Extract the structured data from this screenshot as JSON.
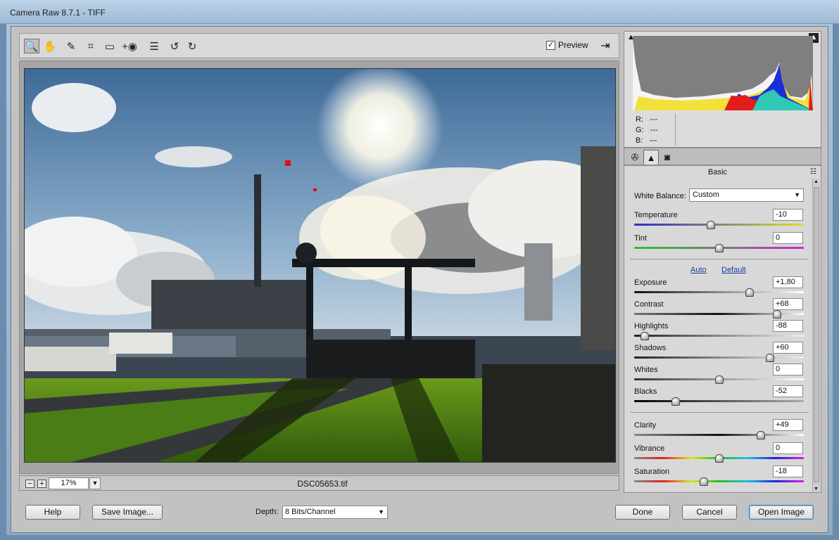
{
  "window": {
    "title": "Camera Raw 8.7.1  -  TIFF"
  },
  "toolbar": {
    "tools": [
      "zoom-tool",
      "hand-tool",
      "white-balance-tool",
      "crop-tool",
      "straighten-tool",
      "red-eye-tool",
      "preferences-tool",
      "rotate-left-tool",
      "rotate-right-tool"
    ],
    "preview_label": "Preview",
    "preview_checked": true
  },
  "status": {
    "zoom_out": "−",
    "zoom_in": "+",
    "zoom_value": "17%",
    "filename": "DSC05653.tif"
  },
  "histogram": {
    "r_label": "R:",
    "r_value": "---",
    "g_label": "G:",
    "g_value": "---",
    "b_label": "B:",
    "b_value": "---"
  },
  "panel": {
    "title": "Basic",
    "white_balance_label": "White Balance:",
    "white_balance_value": "Custom",
    "auto_label": "Auto",
    "default_label": "Default",
    "sliders": {
      "temperature": {
        "label": "Temperature",
        "value": "-10"
      },
      "tint": {
        "label": "Tint",
        "value": "0"
      },
      "exposure": {
        "label": "Exposure",
        "value": "+1,80"
      },
      "contrast": {
        "label": "Contrast",
        "value": "+68"
      },
      "highlights": {
        "label": "Highlights",
        "value": "-88"
      },
      "shadows": {
        "label": "Shadows",
        "value": "+60"
      },
      "whites": {
        "label": "Whites",
        "value": "0"
      },
      "blacks": {
        "label": "Blacks",
        "value": "-52"
      },
      "clarity": {
        "label": "Clarity",
        "value": "+49"
      },
      "vibrance": {
        "label": "Vibrance",
        "value": "0"
      },
      "saturation": {
        "label": "Saturation",
        "value": "-18"
      }
    }
  },
  "footer": {
    "help_label": "Help",
    "save_label": "Save Image...",
    "depth_label": "Depth:",
    "depth_value": "8 Bits/Channel",
    "done_label": "Done",
    "cancel_label": "Cancel",
    "open_label": "Open Image"
  }
}
